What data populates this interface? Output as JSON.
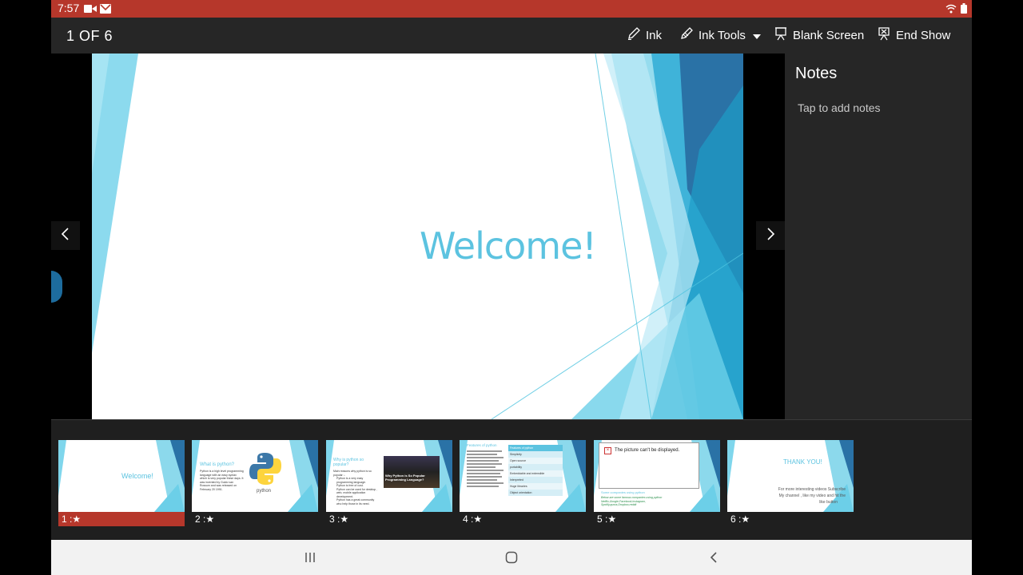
{
  "status_bar": {
    "time": "7:57"
  },
  "toolbar": {
    "counter": "1 OF 6",
    "ink": "Ink",
    "ink_tools": "Ink Tools",
    "blank_screen": "Blank Screen",
    "end_show": "End Show"
  },
  "slide": {
    "title": "Welcome!"
  },
  "notes": {
    "title": "Notes",
    "placeholder": "Tap to add notes"
  },
  "thumbnails": [
    {
      "label": "1 :★",
      "title": "Welcome!"
    },
    {
      "label": "2 :★",
      "title": "What is python?",
      "body": "Python is a high level programming language with an easy syntax which is very popular these days. It was invented by Guido van Rossum and was released on February 20 1991.",
      "logo_text": "python"
    },
    {
      "label": "3 :★",
      "title": "Why is python so popular?",
      "body": [
        "Main reasons why python is so popular :-",
        "Python is a very easy programming language.",
        "Python is free of cost.",
        "Python can be used for desktop , web, mobile application development.",
        "Python has a great community who help those in its need."
      ],
      "image_text": "Why Python is So Popular Programming Language?"
    },
    {
      "label": "4 :★",
      "title": "Features of python",
      "table": [
        "Features of python",
        "Simplicity",
        "Open source",
        "portability",
        "Embeddable and extensible",
        "Interpreted",
        "Huge libraries",
        "Object orientation"
      ]
    },
    {
      "label": "5 :★",
      "title": "Some companies using python",
      "missing_picture": "The picture can't be displayed.",
      "body": [
        "Below are some famous companies using python",
        "Netflix,Google,Facebook,Instagram,",
        "Spotify,quora,Dropbox,reddit"
      ]
    },
    {
      "label": "6 :★",
      "title": "THANK YOU!",
      "body": [
        "For more interesting videos Subscribe",
        "My channel , like my video and hit the",
        "like button"
      ]
    }
  ],
  "colors": {
    "status_bar": "#b6372b",
    "accent_selected": "#b6372b",
    "slide_title": "#5cc3e0",
    "toolbar_bg": "#262626"
  },
  "icons": {
    "status_left": [
      "video-camera-icon",
      "gmail-icon"
    ],
    "status_right": [
      "wifi-icon",
      "battery-icon"
    ],
    "toolbar": [
      "pen-icon",
      "ink-tools-icon",
      "blank-screen-icon",
      "end-show-icon"
    ],
    "navigation": [
      "recent-apps-icon",
      "home-icon",
      "back-icon"
    ]
  }
}
